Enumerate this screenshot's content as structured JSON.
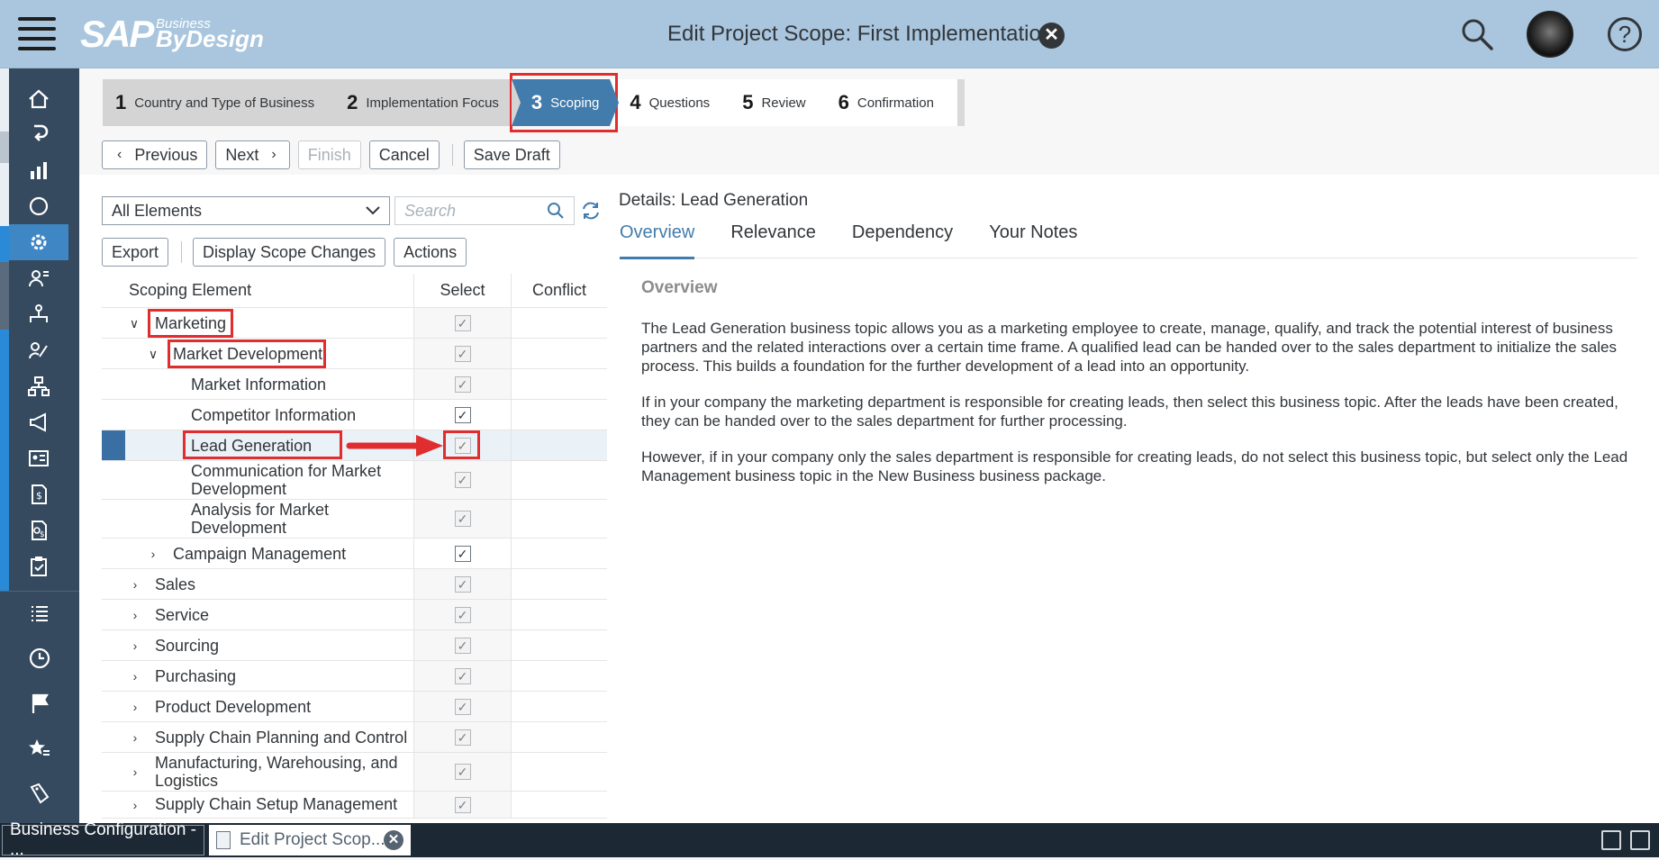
{
  "header": {
    "logo_sap": "SAP",
    "logo_business": "Business",
    "logo_bydesign": "ByDesign",
    "title": "Edit Project Scope: First Implementation"
  },
  "roadmap": {
    "steps": [
      {
        "num": "1",
        "label": "Country and Type of Business"
      },
      {
        "num": "2",
        "label": "Implementation Focus"
      },
      {
        "num": "3",
        "label": "Scoping"
      },
      {
        "num": "4",
        "label": "Questions"
      },
      {
        "num": "5",
        "label": "Review"
      },
      {
        "num": "6",
        "label": "Confirmation"
      }
    ],
    "current_step": 3
  },
  "toolbar": {
    "previous": "Previous",
    "next": "Next",
    "finish": "Finish",
    "cancel": "Cancel",
    "save_draft": "Save Draft"
  },
  "filter": {
    "selected": "All Elements",
    "search_placeholder": "Search"
  },
  "actions": {
    "export": "Export",
    "display_scope_changes": "Display Scope Changes",
    "actions": "Actions"
  },
  "tree": {
    "headers": {
      "element": "Scoping Element",
      "select": "Select",
      "conflict": "Conflict"
    },
    "rows": [
      {
        "label": "Marketing",
        "level": 1,
        "expanded": true,
        "checked": true
      },
      {
        "label": "Market Development",
        "level": 2,
        "expanded": true,
        "checked": true
      },
      {
        "label": "Market Information",
        "level": 3,
        "checked": true
      },
      {
        "label": "Competitor Information",
        "level": 3,
        "checked": true
      },
      {
        "label": "Lead Generation",
        "level": 3,
        "checked": true
      },
      {
        "label": "Communication for Market Development",
        "level": 3,
        "checked": true
      },
      {
        "label": "Analysis for Market Development",
        "level": 3,
        "checked": true
      },
      {
        "label": "Campaign Management",
        "level": 2,
        "expanded": false,
        "checked": true
      },
      {
        "label": "Sales",
        "level": 1,
        "expanded": false,
        "checked": true
      },
      {
        "label": "Service",
        "level": 1,
        "expanded": false,
        "checked": true
      },
      {
        "label": "Sourcing",
        "level": 1,
        "expanded": false,
        "checked": true
      },
      {
        "label": "Purchasing",
        "level": 1,
        "expanded": false,
        "checked": true
      },
      {
        "label": "Product Development",
        "level": 1,
        "expanded": false,
        "checked": true
      },
      {
        "label": "Supply Chain Planning and Control",
        "level": 1,
        "expanded": false,
        "checked": true
      },
      {
        "label": "Manufacturing, Warehousing, and Logistics",
        "level": 1,
        "expanded": false,
        "checked": true
      },
      {
        "label": "Supply Chain Setup Management",
        "level": 1,
        "expanded": false,
        "checked": true
      }
    ]
  },
  "details": {
    "title": "Details: Lead Generation",
    "tabs": [
      "Overview",
      "Relevance",
      "Dependency",
      "Your Notes"
    ],
    "overview_heading": "Overview",
    "paragraphs": [
      "The Lead Generation business topic allows you as a marketing employee to create, manage, qualify, and track the potential interest of business partners and the related interactions over a certain time frame. A qualified lead can be handed over to the sales department to initialize the sales process. This builds a foundation for the further development of a lead into an opportunity.",
      "If in your company the marketing department is responsible for creating leads, then select this business topic. After the leads have been created, they can be handed over to the sales department for further processing.",
      "However, if in your company only the sales department is responsible for creating leads, do not select this business topic, but select only the Lead Management business topic in the New Business business package."
    ]
  },
  "taskbar": {
    "task1": "Business Configuration - ...",
    "task2": "Edit Project Scop..."
  },
  "colors": {
    "shell": "#a9c6de",
    "sidebar": "#354a5f",
    "accent": "#427cac",
    "highlight": "#e02d2d"
  }
}
